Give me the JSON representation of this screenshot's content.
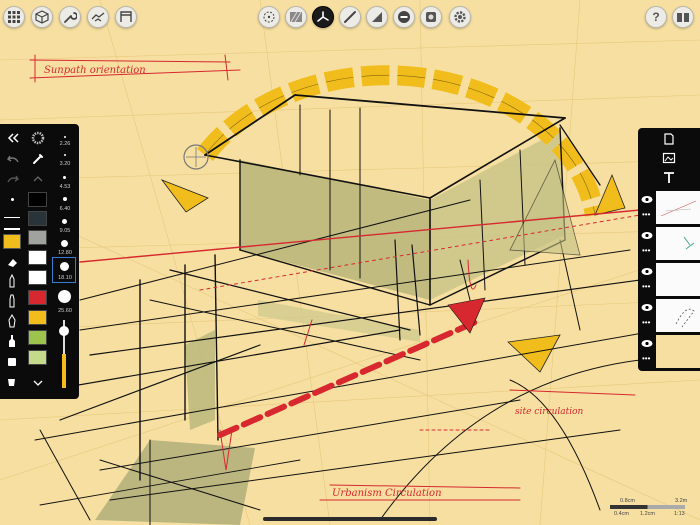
{
  "toolbar": {
    "left_buttons": [
      "grid-icon",
      "cube-icon",
      "wrench-icon",
      "handshake-icon",
      "frame-icon"
    ],
    "center_buttons": [
      "perspective-grid-icon",
      "hatch-icon",
      "vanishing-point-icon",
      "pen-icon",
      "triangle-ruler-icon",
      "minus-icon",
      "stamp-icon",
      "settings-icon"
    ],
    "active": "vanishing-point-icon",
    "help_label": "?"
  },
  "brush_sizes": [
    "2.26",
    "3.20",
    "4.53",
    "6.40",
    "9.05",
    "12.80",
    "18.10",
    "25.60"
  ],
  "selected_size": "18.10",
  "swatches": [
    "#f1bd1c",
    "#ffffff",
    "#ffffff",
    "#ffffff",
    "#d7282f",
    "#f1bd1c",
    "#9dc24e",
    "#c5d98a"
  ],
  "greys": [
    "#000000",
    "#28333a",
    "#9ea49d",
    "#ffffff",
    "#ffffff"
  ],
  "tool_names": [
    "close-palette",
    "undo",
    "redo",
    "brush-dot",
    "line-thin",
    "line-thick",
    "eraser",
    "pencil",
    "marker",
    "ink-pen",
    "fine-liner",
    "airbrush",
    "fill-bucket",
    "expand"
  ],
  "annotations": {
    "top_left": "Sunpath orientation",
    "center_bottom": "Urbanism Circulation",
    "right": "site circulation"
  },
  "layers": {
    "rows": 5,
    "buttons": [
      "new-layer-icon",
      "image-icon",
      "text-icon"
    ]
  },
  "scale": {
    "top": [
      "0.8cm",
      "3.2m"
    ],
    "bottom": [
      "0.4cm",
      "1.2cm",
      "1:13"
    ]
  },
  "colors": {
    "paper": "#f6dfa0",
    "accent_yellow": "#f1bd1c",
    "accent_red": "#d7282f",
    "ink": "#111111",
    "shade": "#b6b77e"
  }
}
